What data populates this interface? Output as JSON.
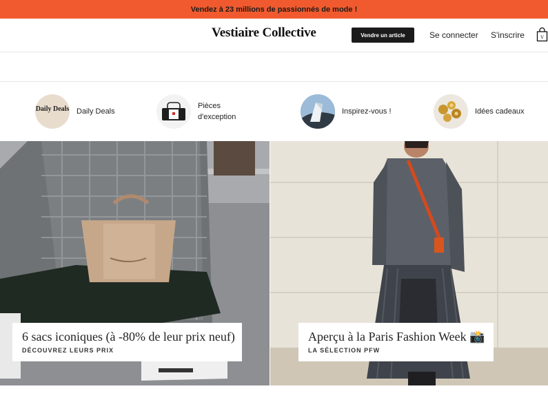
{
  "promo": {
    "text": "Vendez à 23 millions de passionnés de mode !"
  },
  "header": {
    "logo": "Vestiaire Collective",
    "sell_label": "Vendre un article",
    "login_label": "Se connecter",
    "signup_label": "S'inscrire",
    "bag_letter": "V"
  },
  "categories": [
    {
      "label": "Daily Deals",
      "thumb_text": "Daily Deals",
      "icon": "daily-deals-badge"
    },
    {
      "label": "Pièces d'exception",
      "icon": "handbag-photo"
    },
    {
      "label": "Inspirez-vous !",
      "icon": "architecture-photo"
    },
    {
      "label": "Idées cadeaux",
      "icon": "gold-jewelry-photo"
    }
  ],
  "heroes": [
    {
      "title": "6 sacs iconiques (à -80% de leur prix neuf)",
      "subtitle": "DÉCOUVREZ LEURS PRIX"
    },
    {
      "title": "Aperçu à la Paris Fashion Week 📸",
      "subtitle": "LA SÉLECTION PFW"
    }
  ],
  "colors": {
    "promo_bg": "#f15a2e",
    "button_bg": "#1b1b1b"
  }
}
